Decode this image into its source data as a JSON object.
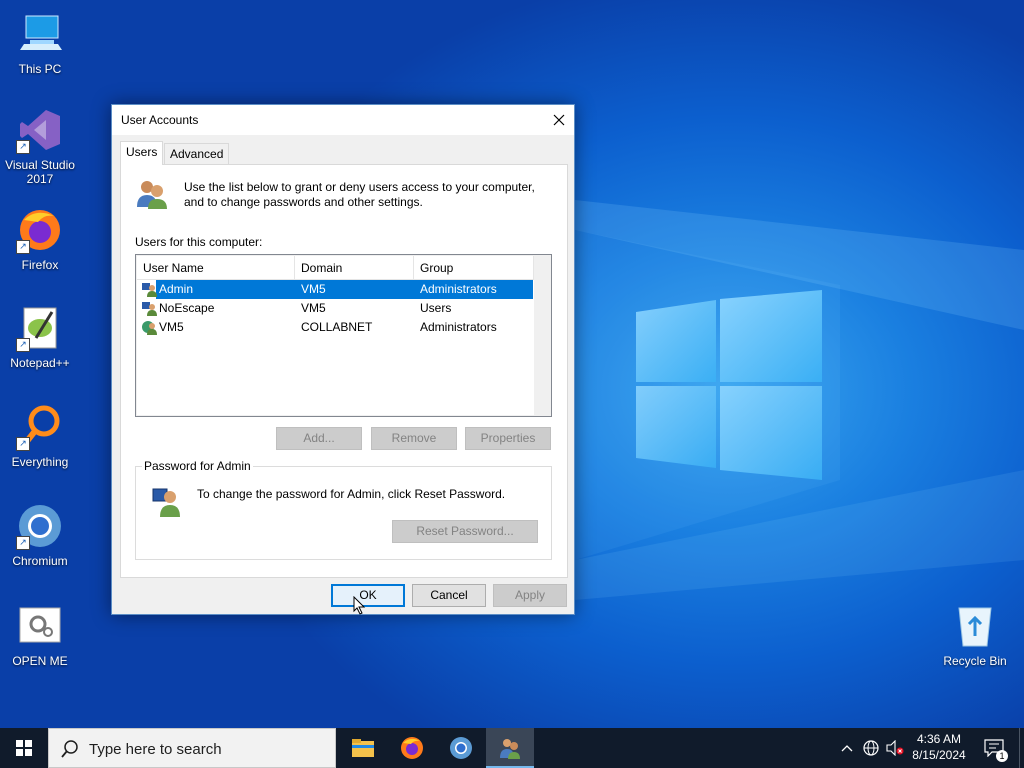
{
  "desktop": {
    "icons": [
      {
        "label": "This PC",
        "icon": "this-pc-icon"
      },
      {
        "label": "Visual Studio 2017",
        "icon": "visual-studio-icon"
      },
      {
        "label": "Firefox",
        "icon": "firefox-icon"
      },
      {
        "label": "Notepad++",
        "icon": "notepad-plus-plus-icon"
      },
      {
        "label": "Everything",
        "icon": "everything-search-icon"
      },
      {
        "label": "Chromium",
        "icon": "chromium-icon"
      },
      {
        "label": "OPEN ME",
        "icon": "settings-file-icon"
      },
      {
        "label": "Recycle Bin",
        "icon": "recycle-bin-icon"
      }
    ]
  },
  "dialog": {
    "title": "User Accounts",
    "tabs": [
      {
        "label": "Users",
        "active": true
      },
      {
        "label": "Advanced",
        "active": false
      }
    ],
    "info_text": "Use the list below to grant or deny users access to your computer, and to change passwords and other settings.",
    "users_label": "Users for this computer:",
    "columns": [
      "User Name",
      "Domain",
      "Group"
    ],
    "rows": [
      {
        "user": "Admin",
        "domain": "VM5",
        "group": "Administrators",
        "selected": true
      },
      {
        "user": "NoEscape",
        "domain": "VM5",
        "group": "Users",
        "selected": false
      },
      {
        "user": "VM5",
        "domain": "COLLABNET",
        "group": "Administrators",
        "selected": false
      }
    ],
    "list_buttons": {
      "add": "Add...",
      "remove": "Remove",
      "properties": "Properties"
    },
    "password_group": {
      "legend": "Password for Admin",
      "text": "To change the password for Admin, click Reset Password.",
      "reset_button": "Reset Password..."
    },
    "footer_buttons": {
      "ok": "OK",
      "cancel": "Cancel",
      "apply": "Apply"
    },
    "accent_color": "#0078d7"
  },
  "taskbar": {
    "search_placeholder": "Type here to search",
    "apps": [
      "file-explorer-icon",
      "firefox-icon",
      "chromium-icon",
      "user-accounts-icon"
    ],
    "active_app": "user-accounts-icon",
    "clock": {
      "time": "4:36 AM",
      "date": "8/15/2024"
    },
    "notification_count": "1"
  }
}
